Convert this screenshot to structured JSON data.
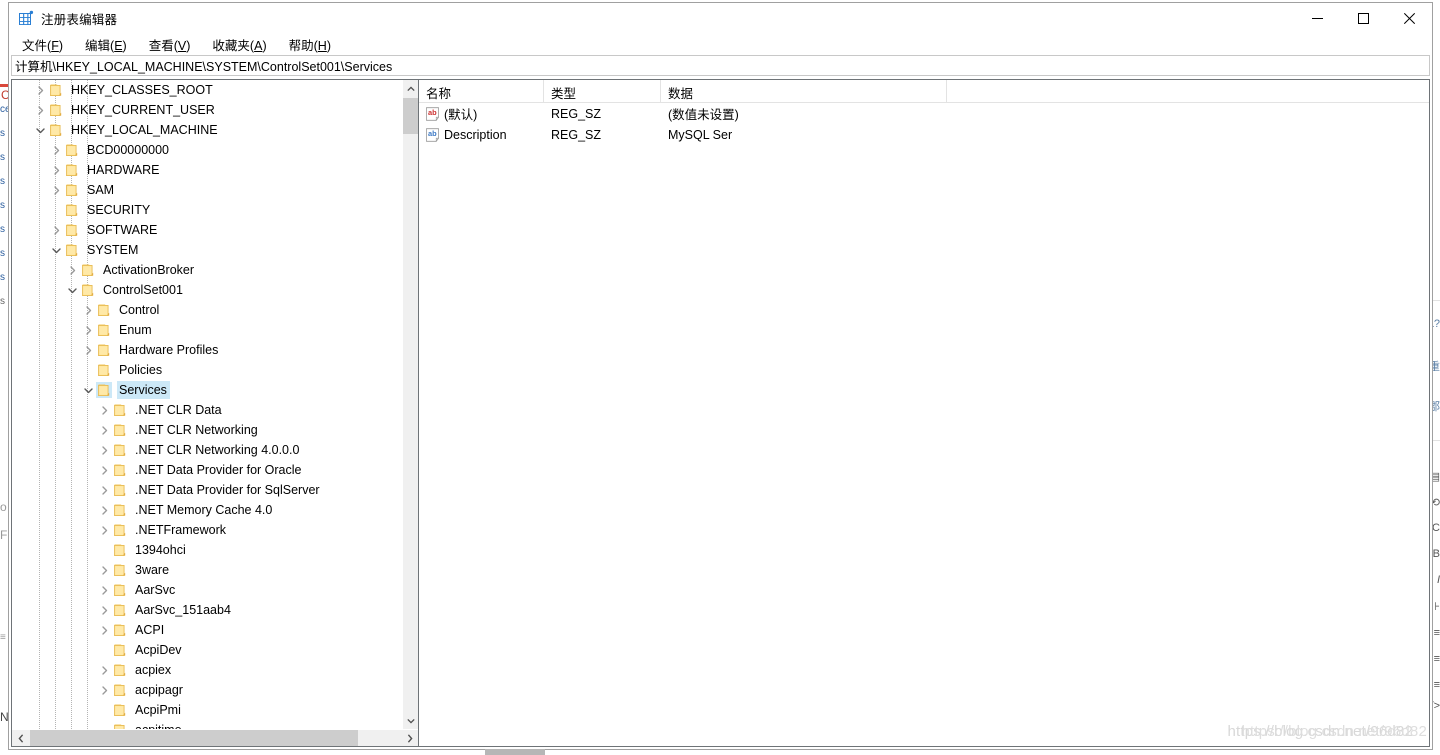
{
  "window": {
    "title": "注册表编辑器",
    "icon": "registry-editor-icon",
    "controls": {
      "minimize": "minimize-icon",
      "maximize": "maximize-icon",
      "close": "close-icon"
    }
  },
  "menubar": {
    "items": [
      {
        "label": "文件",
        "accel": "F"
      },
      {
        "label": "编辑",
        "accel": "E"
      },
      {
        "label": "查看",
        "accel": "V"
      },
      {
        "label": "收藏夹",
        "accel": "A"
      },
      {
        "label": "帮助",
        "accel": "H"
      }
    ]
  },
  "address": {
    "path": "计算机\\HKEY_LOCAL_MACHINE\\SYSTEM\\ControlSet001\\Services"
  },
  "tree": {
    "nodes": [
      {
        "label": "HKEY_CLASSES_ROOT",
        "depth": 1,
        "state": "collapsed",
        "selected": false
      },
      {
        "label": "HKEY_CURRENT_USER",
        "depth": 1,
        "state": "collapsed",
        "selected": false
      },
      {
        "label": "HKEY_LOCAL_MACHINE",
        "depth": 1,
        "state": "expanded",
        "selected": false
      },
      {
        "label": "BCD00000000",
        "depth": 2,
        "state": "collapsed",
        "selected": false
      },
      {
        "label": "HARDWARE",
        "depth": 2,
        "state": "collapsed",
        "selected": false
      },
      {
        "label": "SAM",
        "depth": 2,
        "state": "collapsed",
        "selected": false
      },
      {
        "label": "SECURITY",
        "depth": 2,
        "state": "leaf",
        "selected": false
      },
      {
        "label": "SOFTWARE",
        "depth": 2,
        "state": "collapsed",
        "selected": false
      },
      {
        "label": "SYSTEM",
        "depth": 2,
        "state": "expanded",
        "selected": false
      },
      {
        "label": "ActivationBroker",
        "depth": 3,
        "state": "collapsed",
        "selected": false
      },
      {
        "label": "ControlSet001",
        "depth": 3,
        "state": "expanded",
        "selected": false
      },
      {
        "label": "Control",
        "depth": 4,
        "state": "collapsed",
        "selected": false
      },
      {
        "label": "Enum",
        "depth": 4,
        "state": "collapsed",
        "selected": false
      },
      {
        "label": "Hardware Profiles",
        "depth": 4,
        "state": "collapsed",
        "selected": false
      },
      {
        "label": "Policies",
        "depth": 4,
        "state": "leaf",
        "selected": false
      },
      {
        "label": "Services",
        "depth": 4,
        "state": "expanded",
        "selected": true
      },
      {
        "label": ".NET CLR Data",
        "depth": 5,
        "state": "collapsed",
        "selected": false
      },
      {
        "label": ".NET CLR Networking",
        "depth": 5,
        "state": "collapsed",
        "selected": false
      },
      {
        "label": ".NET CLR Networking 4.0.0.0",
        "depth": 5,
        "state": "collapsed",
        "selected": false
      },
      {
        "label": ".NET Data Provider for Oracle",
        "depth": 5,
        "state": "collapsed",
        "selected": false
      },
      {
        "label": ".NET Data Provider for SqlServer",
        "depth": 5,
        "state": "collapsed",
        "selected": false
      },
      {
        "label": ".NET Memory Cache 4.0",
        "depth": 5,
        "state": "collapsed",
        "selected": false
      },
      {
        "label": ".NETFramework",
        "depth": 5,
        "state": "collapsed",
        "selected": false
      },
      {
        "label": "1394ohci",
        "depth": 5,
        "state": "leaf",
        "selected": false
      },
      {
        "label": "3ware",
        "depth": 5,
        "state": "collapsed",
        "selected": false
      },
      {
        "label": "AarSvc",
        "depth": 5,
        "state": "collapsed",
        "selected": false
      },
      {
        "label": "AarSvc_151aab4",
        "depth": 5,
        "state": "collapsed",
        "selected": false
      },
      {
        "label": "ACPI",
        "depth": 5,
        "state": "collapsed",
        "selected": false
      },
      {
        "label": "AcpiDev",
        "depth": 5,
        "state": "leaf",
        "selected": false
      },
      {
        "label": "acpiex",
        "depth": 5,
        "state": "collapsed",
        "selected": false
      },
      {
        "label": "acpipagr",
        "depth": 5,
        "state": "collapsed",
        "selected": false
      },
      {
        "label": "AcpiPmi",
        "depth": 5,
        "state": "leaf",
        "selected": false
      },
      {
        "label": "acpitime",
        "depth": 5,
        "state": "leaf",
        "selected": false
      }
    ]
  },
  "list": {
    "columns": [
      {
        "key": "name",
        "label": "名称"
      },
      {
        "key": "type",
        "label": "类型"
      },
      {
        "key": "data",
        "label": "数据"
      }
    ],
    "rows": [
      {
        "icon": "string-default-icon",
        "name": "(默认)",
        "type": "REG_SZ",
        "data": "(数值未设置)"
      },
      {
        "icon": "string-value-icon",
        "name": "Description",
        "type": "REG_SZ",
        "data": "MySQL Ser"
      }
    ]
  },
  "scrollbars": {
    "tree_vertical": {
      "up": "chevron-up-icon",
      "down": "chevron-down-icon"
    },
    "tree_horizontal": {
      "left": "chevron-left-icon",
      "right": "chevron-right-icon"
    }
  },
  "watermark": {
    "line1": "https://blog.csdn.net/96d82",
    "line2": "https://blog.csdn.net/96d82"
  },
  "background": {
    "left_fragments": [
      "C",
      "ce",
      "s",
      "s",
      "s",
      "s",
      "s",
      "s",
      "s",
      "s"
    ],
    "right_fragments": [
      "a?",
      "重",
      "郡"
    ]
  },
  "colors": {
    "folder": "#ffd96e",
    "selection": "#cce8f7",
    "window_border": "#a0a0a0",
    "pane_border": "#6e7377",
    "scroll_thumb": "#cdcdcd",
    "scroll_track": "#f0f0f0",
    "title_icon": "#2a7fd4",
    "default_value_icon": "#cc2f2f",
    "string_value_icon": "#3b78c4"
  }
}
